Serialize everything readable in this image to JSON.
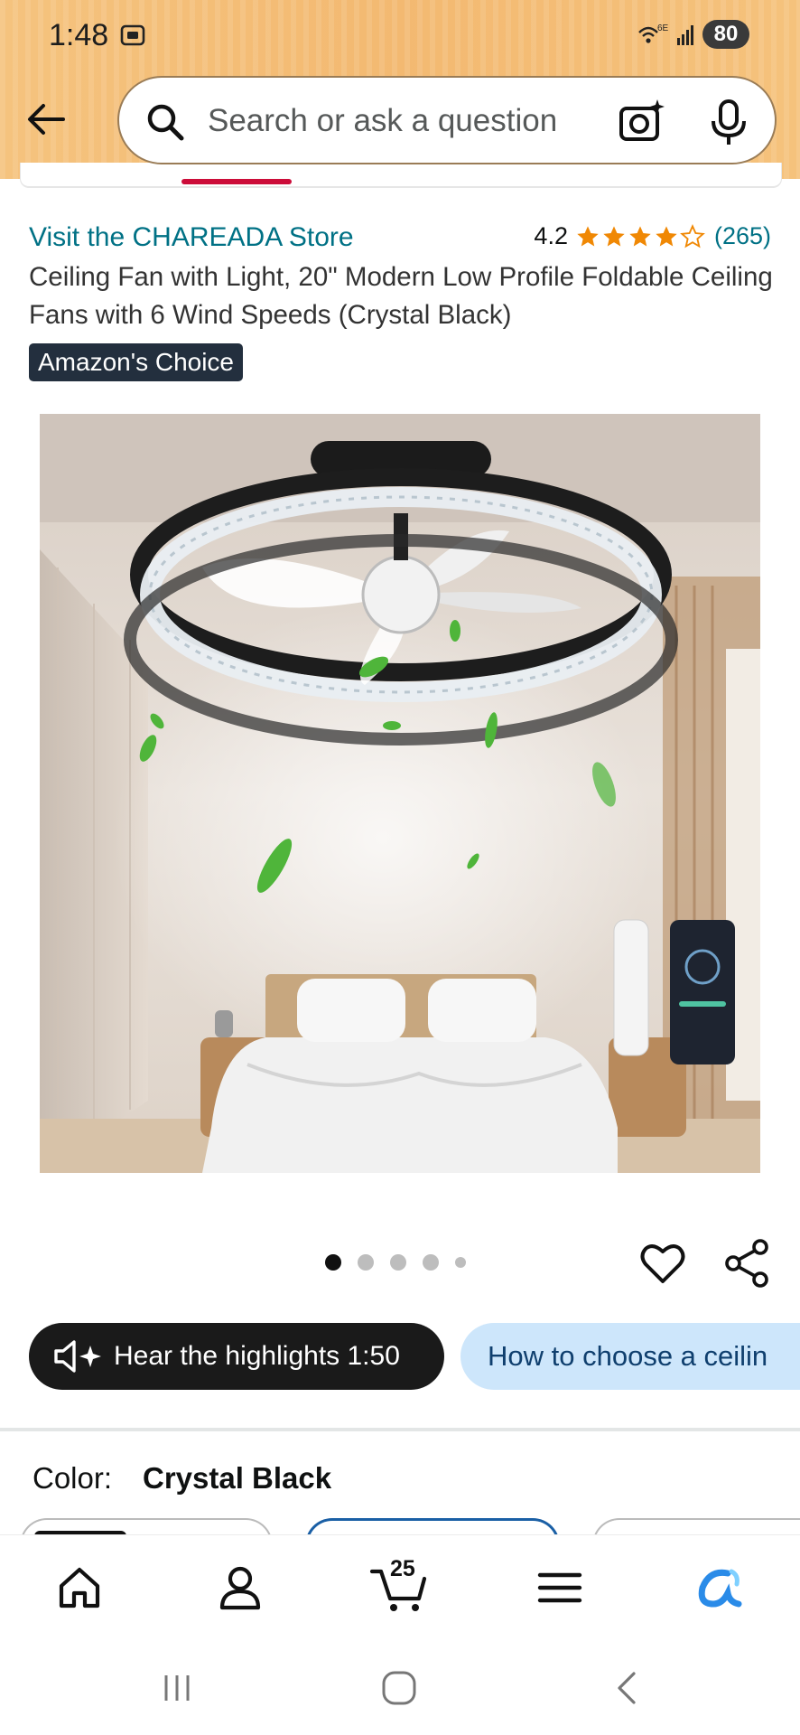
{
  "status_bar": {
    "time": "1:48",
    "network": "6E",
    "battery": "80"
  },
  "search": {
    "placeholder": "Search or ask a question"
  },
  "product": {
    "store_link": "Visit the CHAREADA Store",
    "rating": "4.2",
    "rating_stars": 4.2,
    "review_count": "(265)",
    "title": "Ceiling Fan with Light, 20\" Modern Low Profile Foldable Ceiling Fans with 6 Wind Speeds (Crystal Black)",
    "badge": "Amazon's Choice"
  },
  "carousel": {
    "total_dots": 5,
    "active_index": 0
  },
  "chips": {
    "hear_highlights": "Hear the highlights 1:50",
    "how_to_choose": "How to choose a ceilin"
  },
  "variation": {
    "label": "Color:",
    "value": "Crystal Black"
  },
  "bottom_nav": {
    "items": [
      "home-icon",
      "account-icon",
      "cart-icon",
      "menu-icon",
      "rufus-icon"
    ],
    "cart_count": "25"
  },
  "colors": {
    "link": "#007185",
    "star": "#f08804",
    "badge_bg": "#232f3e",
    "accent_blue": "#1a5fa5",
    "rufus": "#2a8be8"
  }
}
